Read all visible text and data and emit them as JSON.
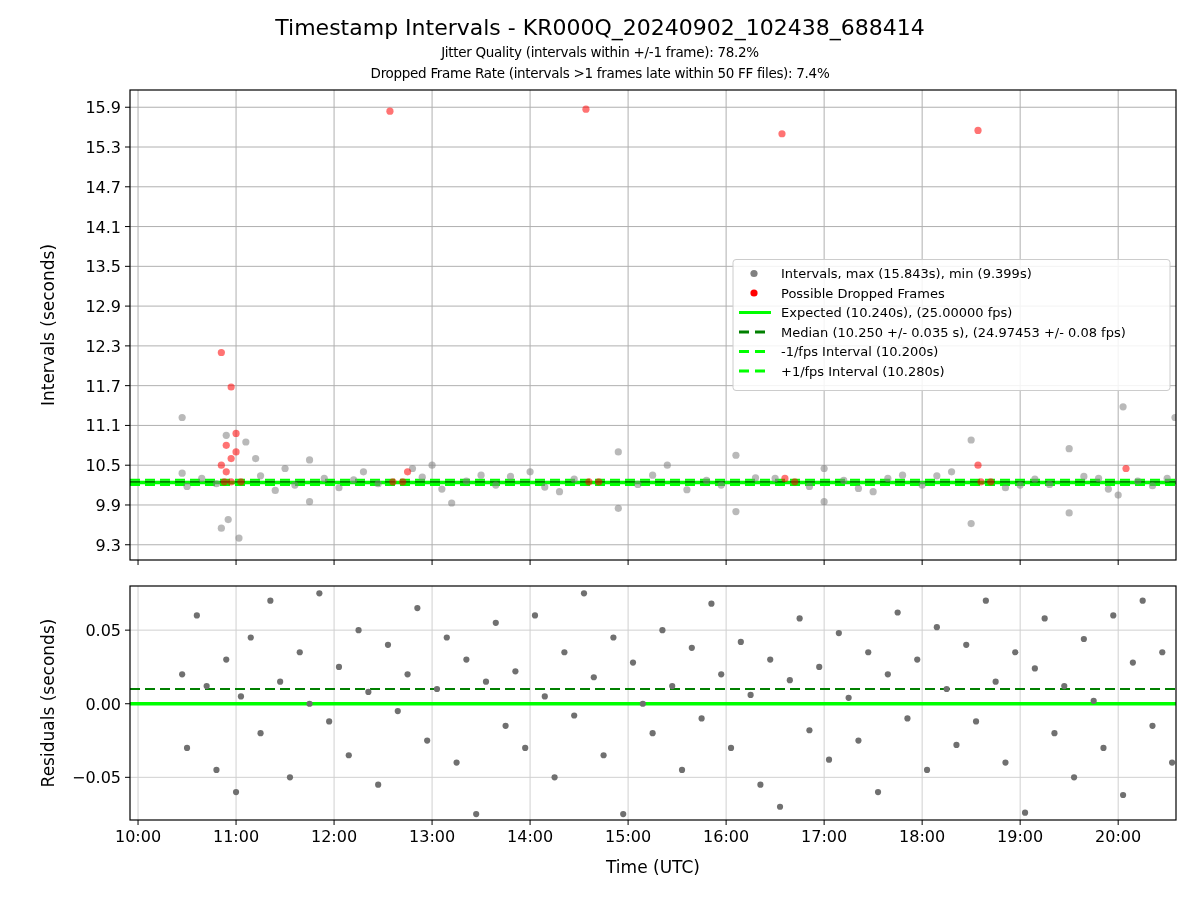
{
  "title": "Timestamp Intervals - KR000Q_20240902_102438_688414",
  "subtitles": [
    "Jitter Quality (intervals within +/-1 frame): 78.2%",
    "Dropped Frame Rate (intervals >1 frames late within 50 FF files): 7.4%"
  ],
  "panels": [
    {
      "chart_data": {
        "type": "scatter",
        "ylabel": "Intervals (seconds)",
        "xlim": [
          9.918,
          20.59
        ],
        "ylim": [
          9.07,
          16.16
        ],
        "yticks": [
          {
            "value": 9.3,
            "label": "9.3"
          },
          {
            "value": 9.9,
            "label": "9.9"
          },
          {
            "value": 10.5,
            "label": "10.5"
          },
          {
            "value": 11.1,
            "label": "11.1"
          },
          {
            "value": 11.7,
            "label": "11.7"
          },
          {
            "value": 12.3,
            "label": "12.3"
          },
          {
            "value": 12.9,
            "label": "12.9"
          },
          {
            "value": 13.5,
            "label": "13.5"
          },
          {
            "value": 14.1,
            "label": "14.1"
          },
          {
            "value": 14.7,
            "label": "14.7"
          },
          {
            "value": 15.3,
            "label": "15.3"
          },
          {
            "value": 15.9,
            "label": "15.9"
          }
        ],
        "series": [
          {
            "name": "Intervals, max (15.843s), min (9.399s)",
            "color": "#808080",
            "x": [
              10.45,
              10.45,
              10.9,
              10.85,
              10.92,
              11.03,
              11.1,
              11.2,
              11.5,
              11.75,
              11.75,
              12.3,
              12.8,
              13.0,
              13.2,
              13.5,
              14.0,
              14.3,
              14.9,
              14.9,
              15.4,
              16.1,
              16.1,
              16.5,
              17.0,
              17.0,
              17.5,
              17.8,
              18.5,
              18.5,
              18.3,
              19.0,
              19.5,
              19.5,
              19.8,
              20.05,
              20.0,
              20.58,
              10.5,
              10.65,
              10.8,
              11.25,
              11.4,
              11.6,
              11.9,
              12.05,
              12.2,
              12.45,
              12.9,
              13.1,
              13.35,
              13.65,
              13.8,
              14.15,
              14.45,
              15.1,
              15.25,
              15.6,
              15.8,
              15.95,
              16.3,
              16.85,
              17.2,
              17.35,
              17.65,
              18.0,
              18.15,
              18.85,
              19.15,
              19.3,
              19.65,
              19.9,
              20.2,
              20.35,
              20.5
            ],
            "values": [
              11.22,
              10.38,
              10.95,
              9.55,
              9.68,
              9.4,
              10.85,
              10.6,
              10.45,
              10.58,
              9.95,
              10.4,
              10.45,
              10.5,
              9.93,
              10.35,
              10.4,
              10.1,
              10.7,
              9.85,
              10.5,
              10.65,
              9.8,
              10.3,
              10.45,
              9.95,
              10.1,
              10.35,
              10.88,
              9.62,
              10.4,
              10.2,
              10.75,
              9.78,
              10.3,
              11.38,
              10.05,
              11.22,
              10.18,
              10.3,
              10.22,
              10.34,
              10.12,
              10.2,
              10.3,
              10.16,
              10.28,
              10.22,
              10.32,
              10.14,
              10.26,
              10.2,
              10.33,
              10.17,
              10.29,
              10.21,
              10.35,
              10.13,
              10.27,
              10.2,
              10.31,
              10.18,
              10.27,
              10.15,
              10.3,
              10.2,
              10.34,
              10.16,
              10.29,
              10.21,
              10.33,
              10.14,
              10.26,
              10.19,
              10.3
            ]
          },
          {
            "name": "Possible Dropped Frames",
            "color": "#ff0000",
            "x": [
              10.85,
              10.95,
              10.9,
              11.0,
              11.0,
              10.95,
              10.85,
              10.9,
              10.88,
              10.95,
              11.05,
              12.57,
              12.6,
              12.7,
              12.75,
              14.57,
              14.6,
              14.7,
              16.57,
              16.6,
              16.7,
              18.57,
              18.57,
              18.6,
              18.7,
              20.08
            ],
            "values": [
              12.2,
              11.68,
              10.8,
              10.98,
              10.7,
              10.6,
              10.5,
              10.4,
              10.25,
              10.25,
              10.25,
              15.84,
              10.25,
              10.25,
              10.4,
              15.87,
              10.25,
              10.25,
              15.5,
              10.3,
              10.25,
              15.55,
              10.5,
              10.25,
              10.25,
              10.45
            ]
          },
          {
            "type": "line",
            "name": "Expected (10.240s), (25.00000 fps)",
            "color": "#00ff00",
            "line_style": "solid",
            "x": [
              9.918,
              20.59
            ],
            "values": [
              10.24,
              10.24
            ]
          },
          {
            "type": "line",
            "name": "Median (10.250 +/- 0.035 s), (24.97453 +/- 0.08 fps)",
            "color": "#008000",
            "line_style": "dashed",
            "x": [
              9.918,
              20.59
            ],
            "values": [
              10.25,
              10.25
            ]
          },
          {
            "type": "line",
            "name": "-1/fps Interval (10.200s)",
            "color": "#00ff00",
            "line_style": "dashed",
            "x": [
              9.918,
              20.59
            ],
            "values": [
              10.2,
              10.2
            ]
          },
          {
            "type": "line",
            "name": "+1/fps Interval (10.280s)",
            "color": "#00ff00",
            "line_style": "dashed",
            "x": [
              9.918,
              20.59
            ],
            "values": [
              10.28,
              10.28
            ]
          }
        ],
        "grid": true,
        "legend": "center right"
      }
    },
    {
      "chart_data": {
        "type": "scatter",
        "xlabel": "Time (UTC)",
        "ylabel": "Residuals (seconds)",
        "xlim": [
          9.918,
          20.59
        ],
        "ylim": [
          -0.079,
          0.08
        ],
        "xticks": [
          {
            "value": 10,
            "label": "10:00"
          },
          {
            "value": 11,
            "label": "11:00"
          },
          {
            "value": 12,
            "label": "12:00"
          },
          {
            "value": 13,
            "label": "13:00"
          },
          {
            "value": 14,
            "label": "14:00"
          },
          {
            "value": 15,
            "label": "15:00"
          },
          {
            "value": 16,
            "label": "16:00"
          },
          {
            "value": 17,
            "label": "17:00"
          },
          {
            "value": 18,
            "label": "18:00"
          },
          {
            "value": 19,
            "label": "19:00"
          },
          {
            "value": 20,
            "label": "20:00"
          }
        ],
        "yticks": [
          {
            "value": -0.05,
            "label": "−0.05"
          },
          {
            "value": 0,
            "label": "0.00"
          },
          {
            "value": 0.05,
            "label": "0.05"
          }
        ],
        "series": [
          {
            "color": "#707070",
            "x": [
              10.45,
              10.5,
              10.6,
              10.7,
              10.8,
              10.9,
              11.0,
              11.05,
              11.15,
              11.25,
              11.35,
              11.45,
              11.55,
              11.65,
              11.75,
              11.85,
              11.95,
              12.05,
              12.15,
              12.25,
              12.35,
              12.45,
              12.55,
              12.65,
              12.75,
              12.85,
              12.95,
              13.05,
              13.15,
              13.25,
              13.35,
              13.45,
              13.55,
              13.65,
              13.75,
              13.85,
              13.95,
              14.05,
              14.15,
              14.25,
              14.35,
              14.45,
              14.55,
              14.65,
              14.75,
              14.85,
              14.95,
              15.05,
              15.15,
              15.25,
              15.35,
              15.45,
              15.55,
              15.65,
              15.75,
              15.85,
              15.95,
              16.05,
              16.15,
              16.25,
              16.35,
              16.45,
              16.55,
              16.65,
              16.75,
              16.85,
              16.95,
              17.05,
              17.15,
              17.25,
              17.35,
              17.45,
              17.55,
              17.65,
              17.75,
              17.85,
              17.95,
              18.05,
              18.15,
              18.25,
              18.35,
              18.45,
              18.55,
              18.65,
              18.75,
              18.85,
              18.95,
              19.05,
              19.15,
              19.25,
              19.35,
              19.45,
              19.55,
              19.65,
              19.75,
              19.85,
              19.95,
              20.05,
              20.15,
              20.25,
              20.35,
              20.45,
              20.55
            ],
            "values": [
              0.02,
              -0.03,
              0.06,
              0.012,
              -0.045,
              0.03,
              -0.06,
              0.005,
              0.045,
              -0.02,
              0.07,
              0.015,
              -0.05,
              0.035,
              0.0,
              0.075,
              -0.012,
              0.025,
              -0.035,
              0.05,
              0.008,
              -0.055,
              0.04,
              -0.005,
              0.02,
              0.065,
              -0.025,
              0.01,
              0.045,
              -0.04,
              0.03,
              -0.075,
              0.015,
              0.055,
              -0.015,
              0.022,
              -0.03,
              0.06,
              0.005,
              -0.05,
              0.035,
              -0.008,
              0.075,
              0.018,
              -0.035,
              0.045,
              -0.075,
              0.028,
              0.0,
              -0.02,
              0.05,
              0.012,
              -0.045,
              0.038,
              -0.01,
              0.068,
              0.02,
              -0.03,
              0.042,
              0.006,
              -0.055,
              0.03,
              -0.07,
              0.016,
              0.058,
              -0.018,
              0.025,
              -0.038,
              0.048,
              0.004,
              -0.025,
              0.035,
              -0.06,
              0.02,
              0.062,
              -0.01,
              0.03,
              -0.045,
              0.052,
              0.01,
              -0.028,
              0.04,
              -0.012,
              0.07,
              0.015,
              -0.04,
              0.035,
              -0.074,
              0.024,
              0.058,
              -0.02,
              0.012,
              -0.05,
              0.044,
              0.002,
              -0.03,
              0.06,
              -0.062,
              0.028,
              0.07,
              -0.015,
              0.035,
              -0.04
            ]
          },
          {
            "type": "line",
            "color": "#00ff00",
            "line_style": "solid",
            "x": [
              9.918,
              20.59
            ],
            "values": [
              0,
              0
            ]
          },
          {
            "type": "line",
            "color": "#008000",
            "line_style": "dashed",
            "x": [
              9.918,
              20.59
            ],
            "values": [
              0.01,
              0.01
            ]
          }
        ],
        "grid": true
      }
    }
  ]
}
